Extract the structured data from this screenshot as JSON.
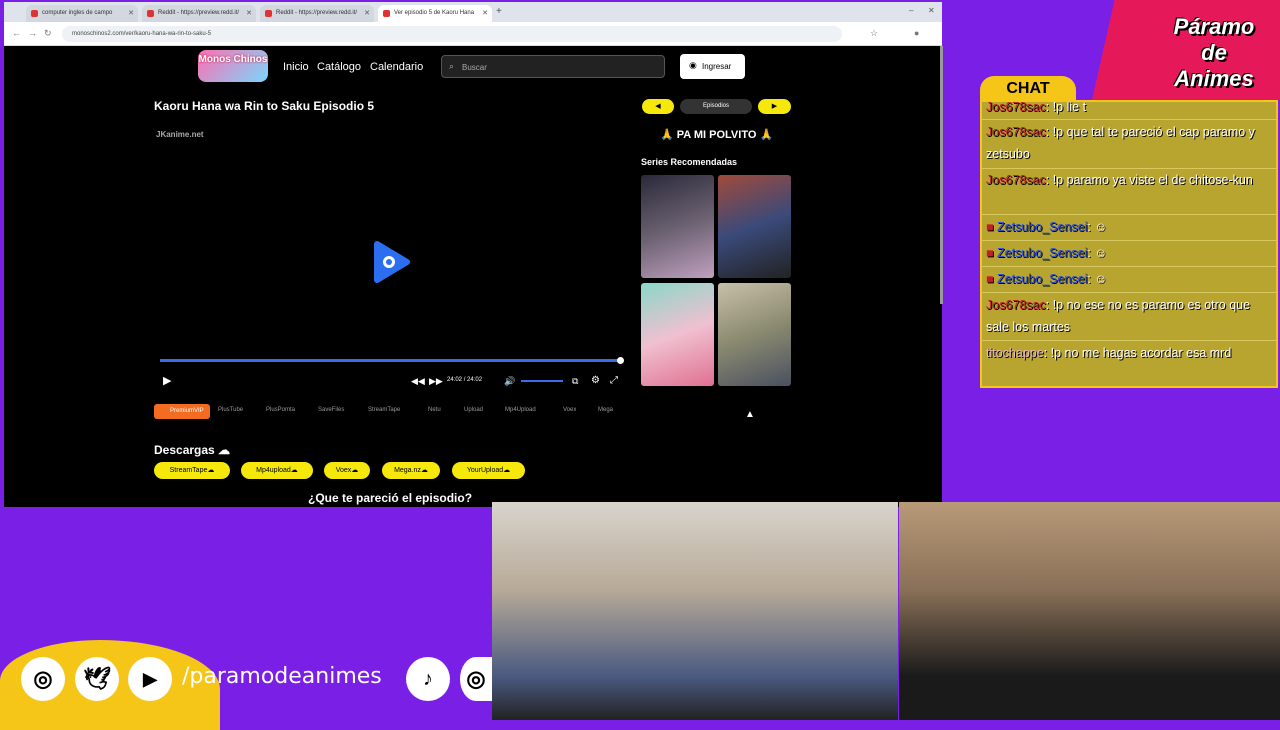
{
  "browser": {
    "tabs": [
      {
        "label": "computer ingles de campo"
      },
      {
        "label": "Reddit - https://preview.redd.it/"
      },
      {
        "label": "Reddit - https://preview.redd.it/"
      },
      {
        "label": "Ver episodio 5 de Kaoru Hana"
      }
    ],
    "url": "monoschinos2.com/ver/kaoru-hana-wa-rin-to-saku-5"
  },
  "site": {
    "logo_text": "Monos Chinos",
    "nav": [
      "Inicio",
      "Catálogo",
      "Calendario"
    ],
    "search_placeholder": "Buscar",
    "login_label": "Ingresar",
    "episode_title": "Kaoru Hana wa Rin to Saku Episodio 5",
    "episodes_label": "Episodios",
    "watermark": "JKanime.net",
    "time_current": "24:02",
    "time_total": "24:02",
    "time_sep": "/",
    "servers_active": "PremiumVIP",
    "servers": [
      "PlusTube",
      "PlusPomta",
      "SaveFiles",
      "StreamTape",
      "Netu",
      "Upload",
      "Mp4Upload",
      "Voex",
      "Mega"
    ],
    "polvito": "🙏 PA MI POLVITO 🙏",
    "recommended_title": "Series Recomendadas",
    "downloads_title": "Descargas ☁",
    "downloads": [
      "StreamTape☁",
      "Mp4upload☁",
      "Voex☁",
      "Mega.nz☁",
      "YourUpload☁"
    ],
    "opinion_title": "¿Que te pareció el episodio?",
    "progress": 1.0,
    "volume": 0.8
  },
  "overlay": {
    "brand_line1": "Páramo",
    "brand_line2": "de",
    "brand_line3": "Animes",
    "chat_header": "CHAT",
    "handle": "/paramodeanimes",
    "chat": [
      {
        "user": "Jos678sac",
        "text": ": !p lie t"
      },
      {
        "user": "Jos678sac",
        "text": ": !p que tal te pareció el cap paramo y zetsubo"
      },
      {
        "user": "Jos678sac",
        "text": ": !p paramo ya viste el de chitose-kun"
      },
      {
        "user": "Zetsubo_Sensei",
        "text": ":"
      },
      {
        "user": "Zetsubo_Sensei",
        "text": ":"
      },
      {
        "user": "Zetsubo_Sensei",
        "text": ":"
      },
      {
        "user": "Jos678sac",
        "text": ": !p no ese no es paramo es otro que sale los martes"
      },
      {
        "user": "titochappe",
        "text": ": !p no me hagas acordar esa mrd"
      }
    ]
  }
}
